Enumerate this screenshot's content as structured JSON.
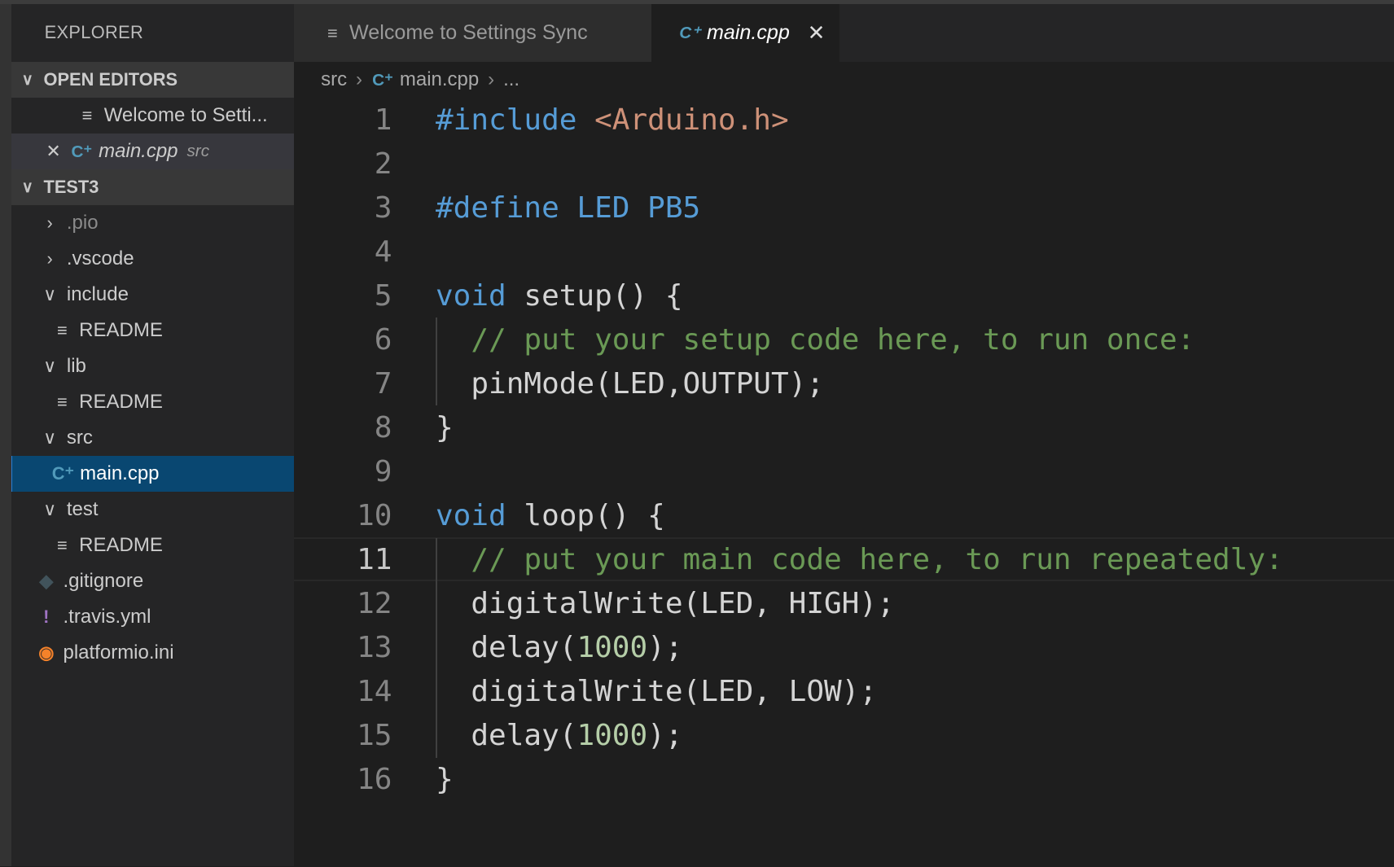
{
  "sidebar": {
    "title": "EXPLORER",
    "open_editors": {
      "label": "OPEN EDITORS",
      "items": [
        {
          "label": "Welcome to Setti...",
          "icon": "lines-icon"
        },
        {
          "label": "main.cpp",
          "description": "src",
          "icon": "cpp-icon"
        }
      ]
    },
    "project": {
      "label": "TEST3",
      "items": [
        {
          "label": ".pio",
          "type": "folder",
          "expanded": false,
          "depth": 0
        },
        {
          "label": ".vscode",
          "type": "folder",
          "expanded": false,
          "depth": 0
        },
        {
          "label": "include",
          "type": "folder",
          "expanded": true,
          "depth": 0
        },
        {
          "label": "README",
          "type": "file",
          "icon": "lines-icon",
          "depth": 1
        },
        {
          "label": "lib",
          "type": "folder",
          "expanded": true,
          "depth": 0
        },
        {
          "label": "README",
          "type": "file",
          "icon": "lines-icon",
          "depth": 1
        },
        {
          "label": "src",
          "type": "folder",
          "expanded": true,
          "depth": 0
        },
        {
          "label": "main.cpp",
          "type": "file",
          "icon": "cpp-icon",
          "depth": 1,
          "selected": true
        },
        {
          "label": "test",
          "type": "folder",
          "expanded": true,
          "depth": 0
        },
        {
          "label": "README",
          "type": "file",
          "icon": "lines-icon",
          "depth": 1
        },
        {
          "label": ".gitignore",
          "type": "file",
          "icon": "git-icon",
          "depth": 0
        },
        {
          "label": ".travis.yml",
          "type": "file",
          "icon": "yaml-icon",
          "depth": 0
        },
        {
          "label": "platformio.ini",
          "type": "file",
          "icon": "platformio-icon",
          "depth": 0
        }
      ]
    }
  },
  "tabs": [
    {
      "label": "Welcome to Settings Sync",
      "active": false
    },
    {
      "label": "main.cpp",
      "active": true
    }
  ],
  "breadcrumb": [
    "src",
    "main.cpp",
    "..."
  ],
  "editor": {
    "current_line": 11,
    "lines": [
      [
        [
          "kw",
          "#include "
        ],
        [
          "str",
          "<Arduino.h>"
        ]
      ],
      [],
      [
        [
          "kw",
          "#define LED PB5"
        ]
      ],
      [],
      [
        [
          "kw",
          "void"
        ],
        [
          "txt",
          " setup() {"
        ]
      ],
      [
        [
          "com",
          "  // put your setup code here, to run once:"
        ]
      ],
      [
        [
          "txt",
          "  pinMode(LED,OUTPUT);"
        ]
      ],
      [
        [
          "txt",
          "}"
        ]
      ],
      [],
      [
        [
          "kw",
          "void"
        ],
        [
          "txt",
          " loop() {"
        ]
      ],
      [
        [
          "com",
          "  // put your main code here, to run repeatedly:"
        ]
      ],
      [
        [
          "txt",
          "  digitalWrite(LED, HIGH);"
        ]
      ],
      [
        [
          "txt",
          "  delay("
        ],
        [
          "num",
          "1000"
        ],
        [
          "txt",
          ");"
        ]
      ],
      [
        [
          "txt",
          "  digitalWrite(LED, LOW);"
        ]
      ],
      [
        [
          "txt",
          "  delay("
        ],
        [
          "num",
          "1000"
        ],
        [
          "txt",
          ");"
        ]
      ],
      [
        [
          "txt",
          "}"
        ]
      ]
    ]
  }
}
